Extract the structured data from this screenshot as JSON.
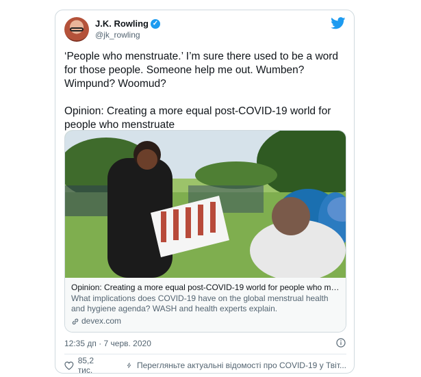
{
  "author": {
    "name": "J.K. Rowling",
    "handle": "@jk_rowling",
    "verified_icon": "verified-badge-icon"
  },
  "tweet": {
    "text": "‘People who menstruate.’ I’m sure there used to be a word for those people. Someone help me out. Wumben? Wimpund? Woomud?\n\nOpinion: Creating a more equal post-COVID-19 world for people who menstruate"
  },
  "link_card": {
    "title": "Opinion: Creating a more equal post-COVID-19 world for people who me...",
    "description": "What implications does COVID-19 have on the global menstrual health and hygiene agenda? WASH and health experts explain.",
    "domain": "devex.com"
  },
  "meta": {
    "timestamp": "12:35 дп · 7 черв. 2020"
  },
  "actions": {
    "like_count": "85,2 тис.",
    "news_text": "Перегляньте актуальні відомості про COVID-19 у Твіт..."
  },
  "colors": {
    "twitter_blue": "#1d9bf0",
    "secondary_text": "#536471",
    "border": "#cfd9de"
  }
}
